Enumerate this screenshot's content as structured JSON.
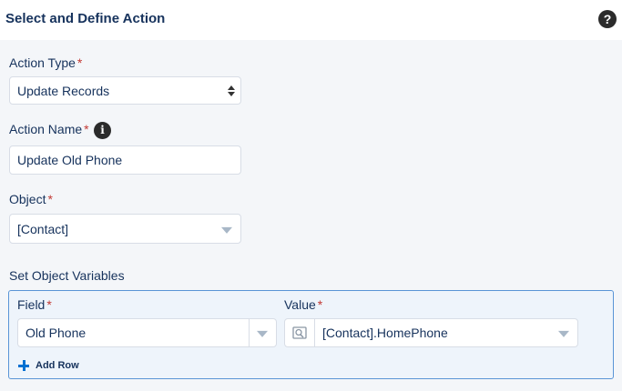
{
  "header": {
    "title": "Select and Define Action",
    "help_icon": "?"
  },
  "form": {
    "required_marker": "*",
    "action_type": {
      "label": "Action Type",
      "value": "Update Records"
    },
    "action_name": {
      "label": "Action Name",
      "value": "Update Old Phone",
      "info_icon": "i"
    },
    "object": {
      "label": "Object",
      "value": "[Contact]"
    },
    "object_variables": {
      "section_label": "Set Object Variables",
      "field_header": "Field",
      "value_header": "Value",
      "rows": [
        {
          "field": "Old Phone",
          "value": "[Contact].HomePhone"
        }
      ],
      "add_row_label": "Add Row"
    }
  },
  "colors": {
    "required": "#c23934",
    "accent": "#0070d2",
    "panel_border": "#5a95d6",
    "text": "#16325c"
  }
}
